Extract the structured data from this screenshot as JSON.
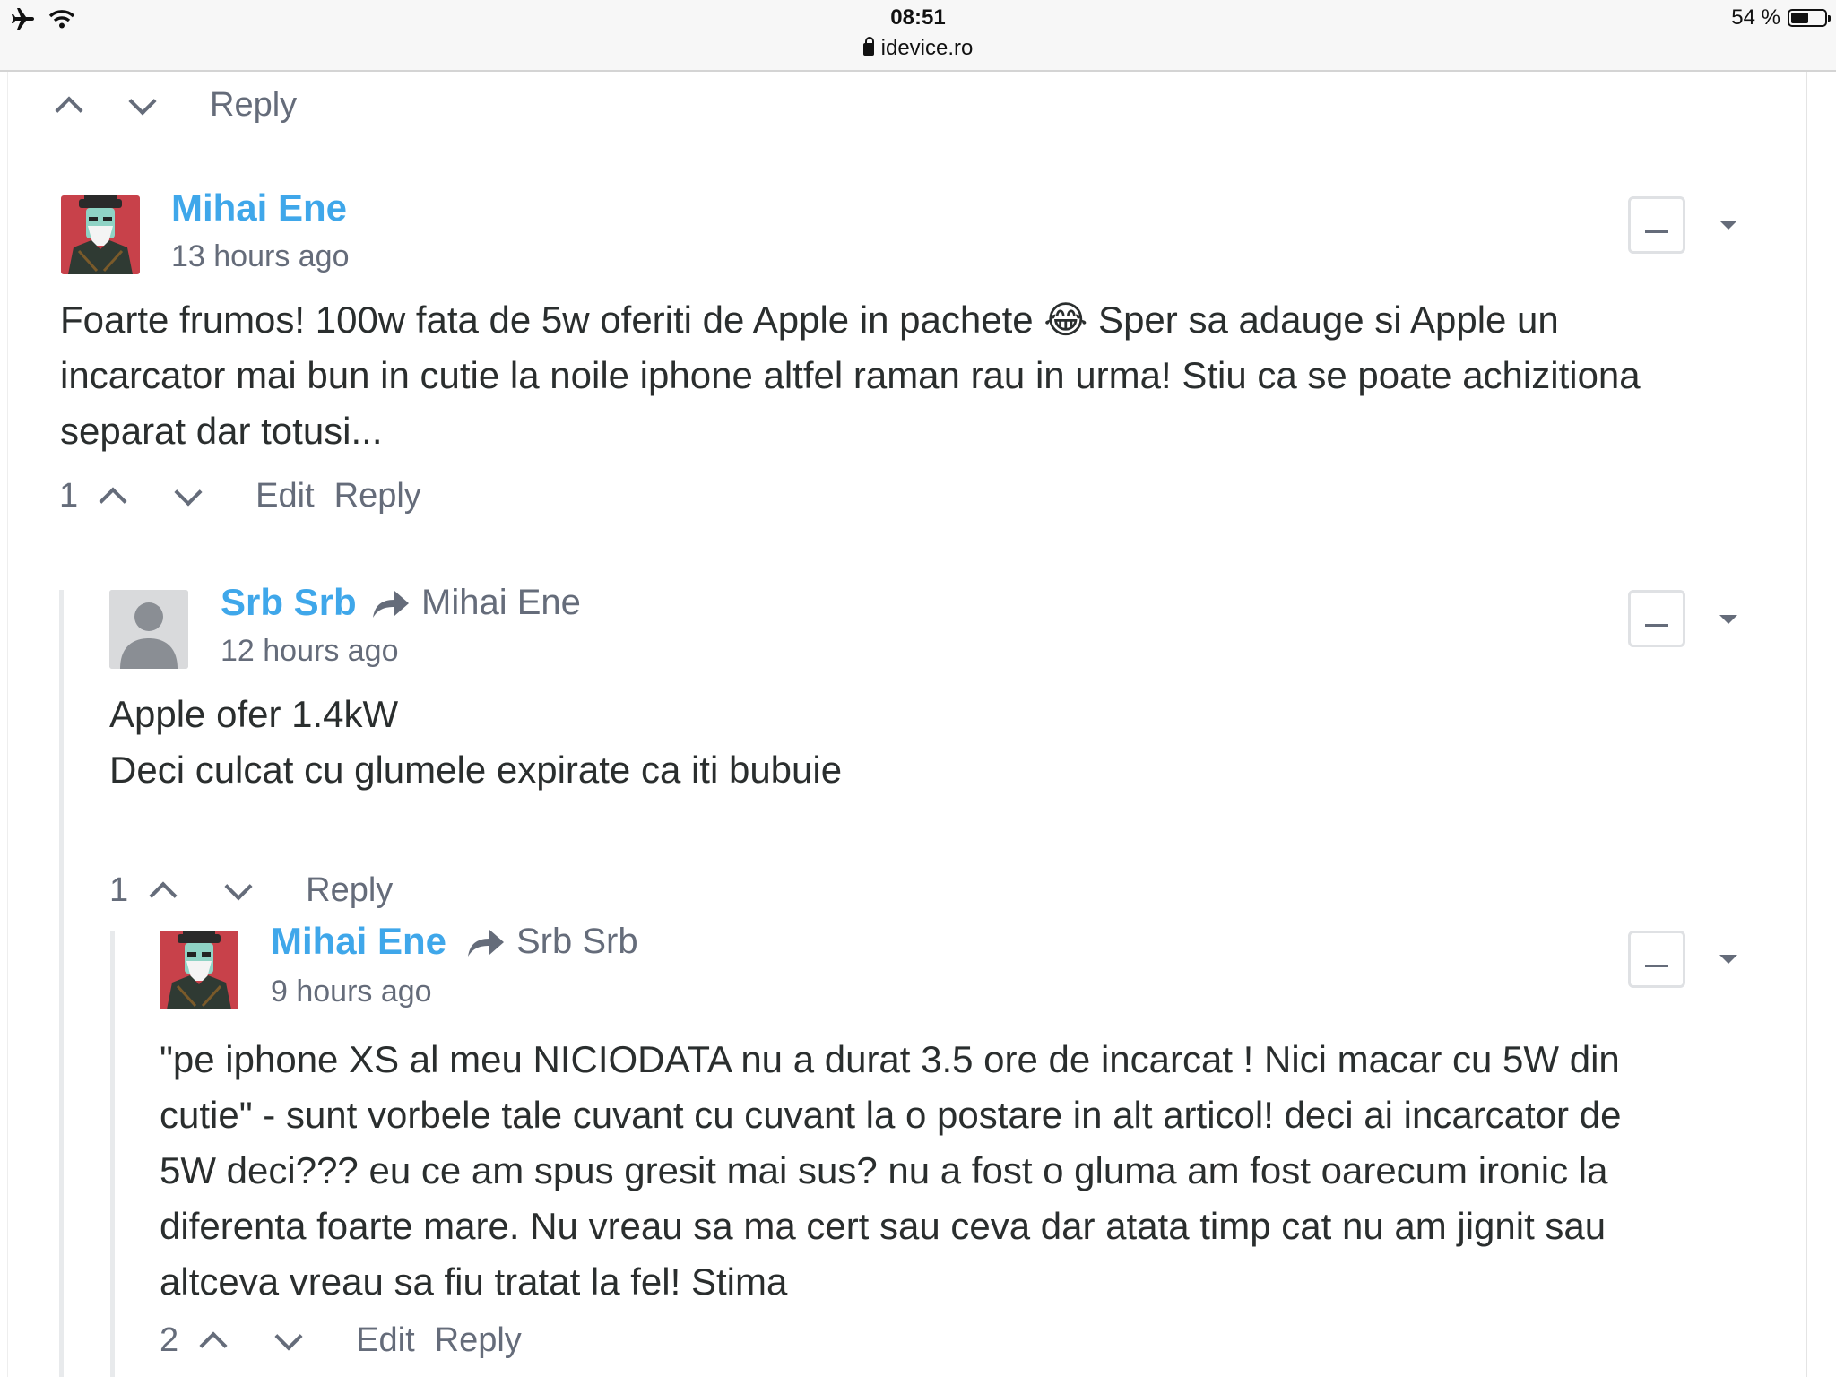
{
  "status_bar": {
    "time": "08:51",
    "url": "idevice.ro",
    "battery_text": "54 %",
    "battery_level": 0.54,
    "icons": [
      "airplane-icon",
      "wifi-icon",
      "lock-icon",
      "battery-icon"
    ]
  },
  "top_actions": {
    "reply_label": "Reply"
  },
  "comments": [
    {
      "author": "Mihai Ene",
      "time": "13 hours ago",
      "lines": [
        "Foarte frumos! 100w fata de 5w oferiti de Apple in pachete 😂 Sper sa adauge si Apple un",
        "incarcator mai bun in cutie la noile iphone altfel raman rau in urma! Stiu ca se poate achizitiona",
        "separat dar totusi..."
      ],
      "votes": "1",
      "edit_label": "Edit",
      "reply_label": "Reply"
    },
    {
      "author": "Srb Srb",
      "reply_to": "Mihai Ene",
      "time": "12 hours ago",
      "lines": [
        "Apple ofer 1.4kW",
        "Deci culcat cu glumele expirate ca iti bubuie"
      ],
      "votes": "1",
      "reply_label": "Reply"
    },
    {
      "author": "Mihai Ene",
      "reply_to": "Srb Srb",
      "time": "9 hours ago",
      "lines": [
        "\"pe iphone XS al meu NICIODATA nu a durat 3.5 ore de incarcat ! Nici macar cu 5W din",
        "cutie\" - sunt vorbele tale cuvant cu cuvant la o postare in alt articol! deci ai incarcator de",
        "5W deci??? eu ce am spus gresit mai sus? nu a fost o gluma am fost oarecum ironic la",
        "diferenta foarte mare. Nu vreau sa ma cert sau ceva dar atata timp cat nu am jignit sau",
        "altceva vreau sa fiu tratat la fel! Stima"
      ],
      "votes": "2",
      "edit_label": "Edit",
      "reply_label": "Reply"
    }
  ],
  "colors": {
    "author": "#3fa7ea",
    "meta": "#656c7a",
    "text": "#2a2e2e",
    "avatar_red": "#c8414a"
  }
}
